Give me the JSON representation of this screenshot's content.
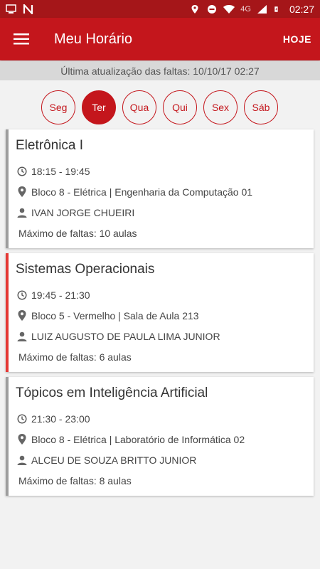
{
  "status_bar": {
    "network": "4G",
    "time": "02:27"
  },
  "app_bar": {
    "title": "Meu Horário",
    "today_label": "HOJE"
  },
  "update_info": "Última atualização das faltas: 10/10/17 02:27",
  "days": [
    {
      "label": "Seg",
      "active": false
    },
    {
      "label": "Ter",
      "active": true
    },
    {
      "label": "Qua",
      "active": false
    },
    {
      "label": "Qui",
      "active": false
    },
    {
      "label": "Sex",
      "active": false
    },
    {
      "label": "Sáb",
      "active": false
    }
  ],
  "classes": [
    {
      "name": "Eletrônica I",
      "time": "18:15 - 19:45",
      "location": "Bloco 8 - Elétrica | Engenharia da Computação 01",
      "teacher": "IVAN JORGE CHUEIRI",
      "max_absences": "Máximo de faltas: 10 aulas"
    },
    {
      "name": "Sistemas Operacionais",
      "time": "19:45 - 21:30",
      "location": "Bloco 5 - Vermelho | Sala de Aula 213",
      "teacher": "LUIZ AUGUSTO DE PAULA LIMA JUNIOR",
      "max_absences": "Máximo de faltas: 6 aulas"
    },
    {
      "name": "Tópicos em Inteligência Artificial",
      "time": "21:30 - 23:00",
      "location": "Bloco 8 - Elétrica | Laboratório de Informática 02",
      "teacher": "ALCEU DE SOUZA BRITTO JUNIOR",
      "max_absences": "Máximo de faltas: 8 aulas"
    }
  ],
  "colors": {
    "primary": "#c4161c",
    "status_bar": "#a51619",
    "active_card_accent": "#e53935"
  }
}
